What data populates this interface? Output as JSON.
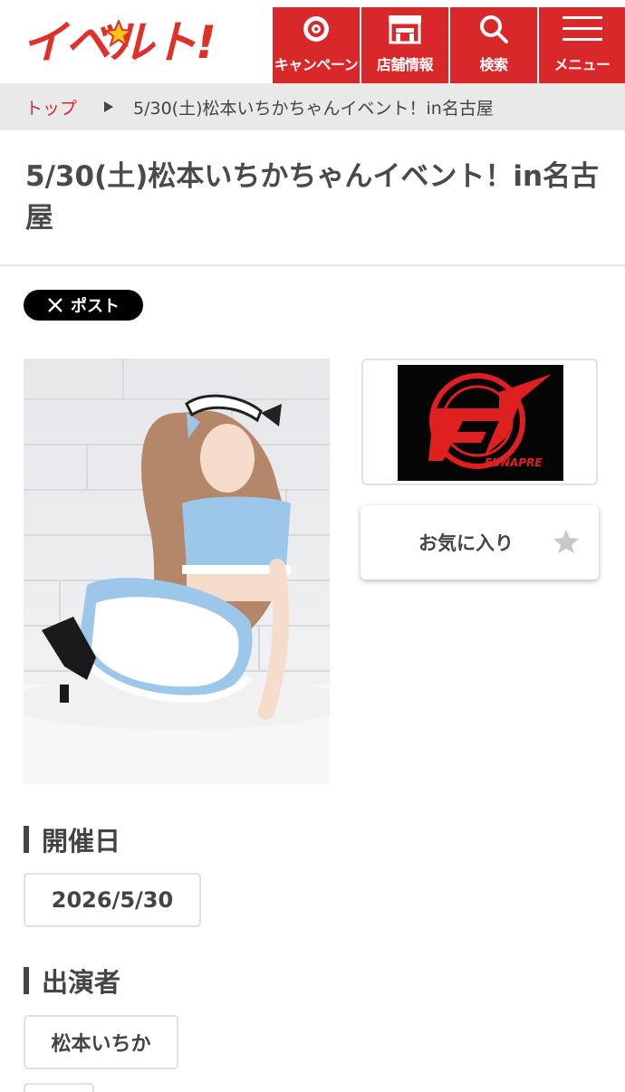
{
  "header": {
    "logo_text": "イベルト!",
    "nav": [
      {
        "label": "キャンペーン",
        "icon": "campaign-icon"
      },
      {
        "label": "店舗情報",
        "icon": "store-icon"
      },
      {
        "label": "検索",
        "icon": "search-icon"
      },
      {
        "label": "メニュー",
        "icon": "hamburger-menu-icon"
      }
    ]
  },
  "breadcrumb": {
    "home": "トップ",
    "current": "5/30(土)松本いちかちゃんイベント！in名古屋"
  },
  "page": {
    "title": "5/30(土)松本いちかちゃんイベント！in名古屋"
  },
  "share": {
    "x_post_label": "ポスト"
  },
  "shop": {
    "logo_text": "FUNAPRE"
  },
  "favorite": {
    "label": "お気に入り"
  },
  "sections": {
    "date_heading": "開催日",
    "date_value": "2026/5/30",
    "performer_heading": "出演者",
    "performer_value": "松本いちか"
  },
  "colors": {
    "brand_red": "#d8282a",
    "breadcrumb_bg": "#e9e9e9",
    "text": "#444444"
  }
}
